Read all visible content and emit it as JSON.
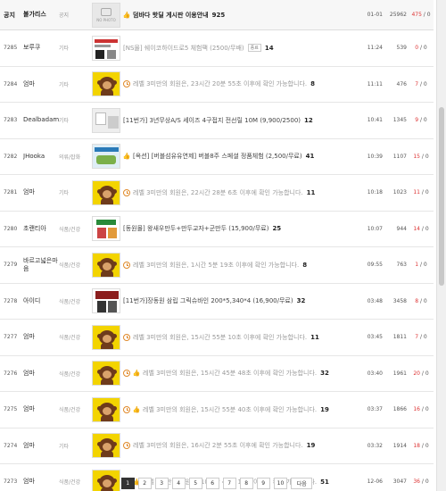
{
  "notice": {
    "num": "공지",
    "name": "불가리스",
    "cat": "공지",
    "thumb_text": "NO PHOTO",
    "title": "덤바다 핫딜 게시판 이용안내",
    "count": "925",
    "time": "01-01",
    "views": "25962",
    "votes_up": "475",
    "votes_down": "0"
  },
  "rows": [
    {
      "num": "7285",
      "name": "보루쿠",
      "cat": "기타",
      "thumb": "shop",
      "icon": "none",
      "title": "[NS몰] 쉐이코하이드로5 체험팩 (2500/무배)",
      "locked": true,
      "count": "14",
      "tag": "종료",
      "time": "11:24",
      "views": "539",
      "votes_up": "0",
      "votes_down": "0"
    },
    {
      "num": "7284",
      "name": "엄마",
      "cat": "기타",
      "thumb": "monkey",
      "icon": "clock",
      "title": "레벨 3미만의 회원은, 23시간 20분 55초 이후에 확인 가능합니다.",
      "locked": true,
      "count": "8",
      "tag": "",
      "time": "11:11",
      "views": "476",
      "votes_up": "7",
      "votes_down": "0"
    },
    {
      "num": "7283",
      "name": "Dealbadamo…",
      "cat": "기타",
      "thumb": "wash",
      "icon": "none",
      "title": "[11번가] 3년무상A/S 세이즈 4구접지 전선릴 10M (9,900/2500)",
      "locked": false,
      "count": "12",
      "tag": "",
      "time": "10:41",
      "views": "1345",
      "votes_up": "9",
      "votes_down": "0"
    },
    {
      "num": "7282",
      "name": "JHooka",
      "cat": "의류/잡화",
      "thumb": "map",
      "icon": "thumb",
      "title": "[옥션] [버블섬유유연제] 버블8주 스페셜 정품체험 (2,500/무료)",
      "locked": false,
      "count": "41",
      "tag": "",
      "time": "10:39",
      "views": "1107",
      "votes_up": "15",
      "votes_down": "0"
    },
    {
      "num": "7281",
      "name": "엄마",
      "cat": "기타",
      "thumb": "monkey",
      "icon": "clock",
      "title": "레벨 3미만의 회원은, 22시간 28분 6초 이후에 확인 가능합니다.",
      "locked": true,
      "count": "11",
      "tag": "",
      "time": "10:18",
      "views": "1023",
      "votes_up": "11",
      "votes_down": "0"
    },
    {
      "num": "7280",
      "name": "초랜티아",
      "cat": "식품/건강",
      "thumb": "food",
      "icon": "none",
      "title": "[동원몰] 왕새우만두+만두교자+군만두 (15,900/무료)",
      "locked": false,
      "count": "25",
      "tag": "",
      "time": "10:07",
      "views": "944",
      "votes_up": "14",
      "votes_down": "0"
    },
    {
      "num": "7279",
      "name": "바르고넓은마음",
      "cat": "식품/건강",
      "thumb": "monkey",
      "icon": "clock",
      "title": "레벨 3미만의 회원은, 1시간 5분 19초 이후에 확인 가능합니다.",
      "locked": true,
      "count": "8",
      "tag": "",
      "time": "09:55",
      "views": "763",
      "votes_up": "1",
      "votes_down": "0"
    },
    {
      "num": "7278",
      "name": "아이디",
      "cat": "식품/건강",
      "thumb": "black",
      "icon": "none",
      "title": "[11번가]장동원 삼립 그릭슈바인 200*5,340*4 (16,900/무료)",
      "locked": false,
      "count": "32",
      "tag": "",
      "time": "03:48",
      "views": "3458",
      "votes_up": "8",
      "votes_down": "0"
    },
    {
      "num": "7277",
      "name": "엄마",
      "cat": "식품/건강",
      "thumb": "monkey",
      "icon": "clock",
      "title": "레벨 3미만의 회원은, 15시간 55분 10초 이후에 확인 가능합니다.",
      "locked": true,
      "count": "11",
      "tag": "",
      "time": "03:45",
      "views": "1811",
      "votes_up": "7",
      "votes_down": "0"
    },
    {
      "num": "7276",
      "name": "엄마",
      "cat": "식품/건강",
      "thumb": "monkey",
      "icon": "both",
      "title": "레벨 3미만의 회원은, 15시간 45분 48초 이후에 확인 가능합니다.",
      "locked": true,
      "count": "32",
      "tag": "",
      "time": "03:40",
      "views": "1961",
      "votes_up": "20",
      "votes_down": "0"
    },
    {
      "num": "7275",
      "name": "엄마",
      "cat": "식품/건강",
      "thumb": "monkey",
      "icon": "both",
      "title": "레벨 3미만의 회원은, 15시간 55분 40초 이후에 확인 가능합니다.",
      "locked": true,
      "count": "19",
      "tag": "",
      "time": "03:37",
      "views": "1866",
      "votes_up": "16",
      "votes_down": "0"
    },
    {
      "num": "7274",
      "name": "엄마",
      "cat": "기타",
      "thumb": "monkey",
      "icon": "clock",
      "title": "레벨 3미만의 회원은, 16시간 2분 55초 이후에 확인 가능합니다.",
      "locked": true,
      "count": "19",
      "tag": "",
      "time": "03:32",
      "views": "1914",
      "votes_up": "18",
      "votes_down": "0"
    },
    {
      "num": "7273",
      "name": "엄마",
      "cat": "식품/건강",
      "thumb": "monkey",
      "icon": "both",
      "title": "레벨 3미만의 회원은, 10시간 46분 19초 이후에 확인 가능합니다.",
      "locked": true,
      "count": "51",
      "tag": "",
      "time": "12-06",
      "views": "3047",
      "votes_up": "36",
      "votes_down": "0"
    }
  ],
  "pagination": {
    "pages": [
      "1",
      "2",
      "3",
      "4",
      "5",
      "6",
      "7",
      "8",
      "9",
      "10"
    ],
    "current": "1",
    "next_label": "다음"
  },
  "colors": {
    "vote_up": "#d33",
    "thumbs_icon": "#4a8bd6",
    "clock_icon": "#e0892a",
    "monkey_bg": "#f3d400"
  }
}
